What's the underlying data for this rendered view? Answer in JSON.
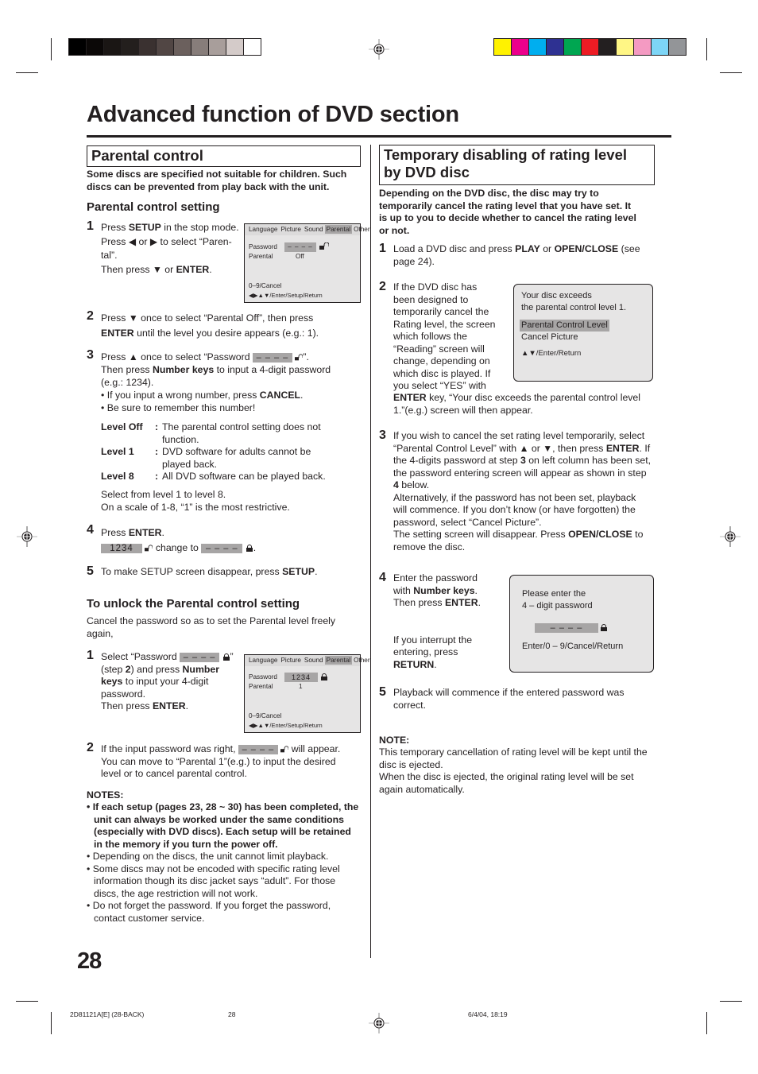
{
  "print_marks": {
    "gray_swatches": [
      "#000000",
      "#0b0807",
      "#1a1614",
      "#231f1d",
      "#3a3130",
      "#514644",
      "#6b605d",
      "#877d7a",
      "#a89e9b",
      "#d4cbc9",
      "#ffffff"
    ],
    "color_swatches": [
      "#fff200",
      "#ec008c",
      "#00aeef",
      "#2e3192",
      "#00a651",
      "#ed1c24",
      "#231f20",
      "#fff685",
      "#f49ac2",
      "#7dd5f6",
      "#939598"
    ]
  },
  "page_title": "Advanced function of DVD section",
  "left": {
    "section_title": "Parental control",
    "intro": "Some discs are specified not suitable for children. Such discs can be prevented from play back with the unit.",
    "setting_heading": "Parental control setting",
    "steps": [
      {
        "num": "1",
        "lines": [
          "Press ",
          "SETUP",
          " in the stop mode.",
          "Press ",
          "◀",
          " or ",
          "▶",
          " to select “Paren-",
          "tal”.",
          "Then press ",
          "▼",
          " or ",
          "ENTER",
          "."
        ]
      },
      {
        "num": "2",
        "text_a": "Press ",
        "arrow": "▼",
        "text_b": " once to select “Parental Off”, then press",
        "bold_a": "ENTER",
        "text_c": " until the level you desire appears (e.g.: 1)."
      },
      {
        "num": "3",
        "text_a": "Press ",
        "arrow": "▲",
        "text_b": " once to select “Password ",
        "pw": "– – – –",
        "text_c": "”.",
        "line2_a": "Then press ",
        "line2_bold": "Number keys",
        "line2_b": " to input a 4-digit password",
        "line3": "(e.g.: 1234).",
        "bullet1_a": "• If you input a wrong number, press ",
        "bullet1_bold": "CANCEL",
        "bullet1_b": ".",
        "bullet2": "• Be sure to remember this number!"
      },
      {
        "num": "4",
        "text_a": "Press ",
        "bold_a": "ENTER",
        "text_b": ".",
        "from_pw": "1234",
        "change_to": " change to ",
        "to_pw": "– – – –",
        "end": "."
      },
      {
        "num": "5",
        "text_a": "To make SETUP screen disappear, press ",
        "bold_a": "SETUP",
        "text_b": "."
      }
    ],
    "levels": [
      {
        "label": "Level Off",
        "desc": "The parental control setting does not function."
      },
      {
        "label": "Level 1",
        "desc": "DVD software for adults cannot be played back."
      },
      {
        "label": "Level 8",
        "desc": "All DVD software can be played back."
      }
    ],
    "level_note_1": "Select from level 1 to level 8.",
    "level_note_2": "On a scale of 1-8, “1” is the most restrictive.",
    "osd1": {
      "tabs": [
        "Language",
        "Picture",
        "Sound",
        "Parental",
        "Other"
      ],
      "active_tab": "Parental",
      "password_label": "Password",
      "password_value": "– – – –",
      "parental_label": "Parental",
      "parental_value": "Off",
      "hint1": "0–9/Cancel",
      "hint2": "◀▶▲▼/Enter/Setup/Return"
    },
    "unlock_heading": "To unlock the Parental control setting",
    "unlock_intro": "Cancel the password so as to set the Parental level freely again,",
    "unlock_steps": [
      {
        "num": "1",
        "text_a": "Select “Password ",
        "pw": "– – – –",
        "text_b": "”",
        "line2_a": "(step ",
        "line2_bold": "2",
        "line2_b": ") and press ",
        "line2_bold2": "Number",
        "line3_bold": "keys",
        "line3_b": " to input your 4-digit",
        "line4": "password.",
        "line5_a": "Then press ",
        "line5_bold": "ENTER",
        "line5_b": "."
      },
      {
        "num": "2",
        "text_a": "If the input password was right, ",
        "pw": "– – – –",
        "text_b": " will appear.",
        "line2": "You can move to “Parental 1”(e.g.) to input the desired",
        "line3": "level or to cancel parental control."
      }
    ],
    "osd2": {
      "tabs": [
        "Language",
        "Picture",
        "Sound",
        "Parental",
        "Other"
      ],
      "active_tab": "Parental",
      "password_label": "Password",
      "password_value": "1234",
      "parental_label": "Parental",
      "parental_value": "1",
      "hint1": "0–9/Cancel",
      "hint2": "◀▶▲▼/Enter/Setup/Return"
    },
    "notes_heading": "NOTES:",
    "notes": [
      {
        "bold": true,
        "text": "If each setup (pages 23, 28 ~ 30) has been   completed, the unit can always be worked under the same conditions (especially with DVD discs). Each setup will be retained in the memory if you turn the power off."
      },
      {
        "bold": false,
        "text": "Depending on the discs, the unit cannot limit playback."
      },
      {
        "bold": false,
        "text": "Some discs may not be encoded with specific rating level information though its disc jacket says “adult”. For those discs, the age restriction will not work."
      },
      {
        "bold": false,
        "text": "Do not forget the password. If you forget the password, contact customer service."
      }
    ]
  },
  "right": {
    "section_title_1": "Temporary disabling of rating level",
    "section_title_2": "by DVD disc",
    "intro": "Depending on the DVD disc, the disc may try to temporarily cancel the rating level that you have set. It is up to you to decide whether to cancel the rating level or not.",
    "step1": {
      "num": "1",
      "a": "Load a DVD disc and press ",
      "b1": "PLAY",
      "c": " or ",
      "b2": "OPEN/CLOSE",
      "d": " (see page 24)."
    },
    "step2": {
      "num": "2",
      "lines": [
        "If the DVD disc has",
        "been designed to",
        "temporarily cancel the",
        "Rating level, the screen",
        "which follows the",
        "“Reading” screen will",
        "change, depending on",
        "which disc is played. If",
        "you select “YES” with"
      ],
      "tail_bold": "ENTER",
      "tail": " key, “Your disc exceeds the parental control level 1.”(e.g.) screen will then appear."
    },
    "osd3": {
      "line1": "Your disc exceeds",
      "line2": "the parental control level 1.",
      "option1": "Parental Control Level",
      "option2": "Cancel Picture",
      "hint": "▲▼/Enter/Return"
    },
    "step3": {
      "num": "3",
      "p1": "If you wish to cancel the set rating level temporarily, select “Parental Control Level” with ",
      "up": "▲",
      "or": " or ",
      "down": "▼",
      "p2": ", then press ",
      "b1": "ENTER",
      "p3": ". If the 4-digits password at step ",
      "b2": "3",
      "p4": " on left column has been set, the password entering screen will appear as shown in step ",
      "b3": "4",
      "p5": " below.",
      "p6": "Alternatively, if the password has not been set, playback will commence. If you don’t know (or have forgotten) the password, select “Cancel Picture”.",
      "p7": "The setting screen will disappear. Press ",
      "b4": "OPEN/CLOSE",
      "p8": " to remove the disc."
    },
    "step4": {
      "num": "4",
      "a": "Enter the password",
      "b": "with ",
      "b_bold": "Number keys",
      "b_end": ".",
      "c": "Then press ",
      "c_bold": "ENTER",
      "c_end": ".",
      "d": "If you interrupt the",
      "e": "entering, press",
      "f_bold": "RETURN",
      "f_end": "."
    },
    "osd4": {
      "line1": "Please enter the",
      "line2": "4 – digit password",
      "pw": "– – – –",
      "hint": "Enter/0 – 9/Cancel/Return"
    },
    "step5": {
      "num": "5",
      "text": "Playback will commence if the entered password was correct."
    },
    "note_heading": "NOTE:",
    "note_1": "This temporary cancellation of rating level will be kept until the disc is ejected.",
    "note_2": "When the disc is ejected, the original rating level will be set again automatically."
  },
  "page_number": "28",
  "footer": {
    "doc_code": "2D81121A[E] (28-BACK)",
    "page": "28",
    "timestamp": "6/4/04, 18:19"
  }
}
